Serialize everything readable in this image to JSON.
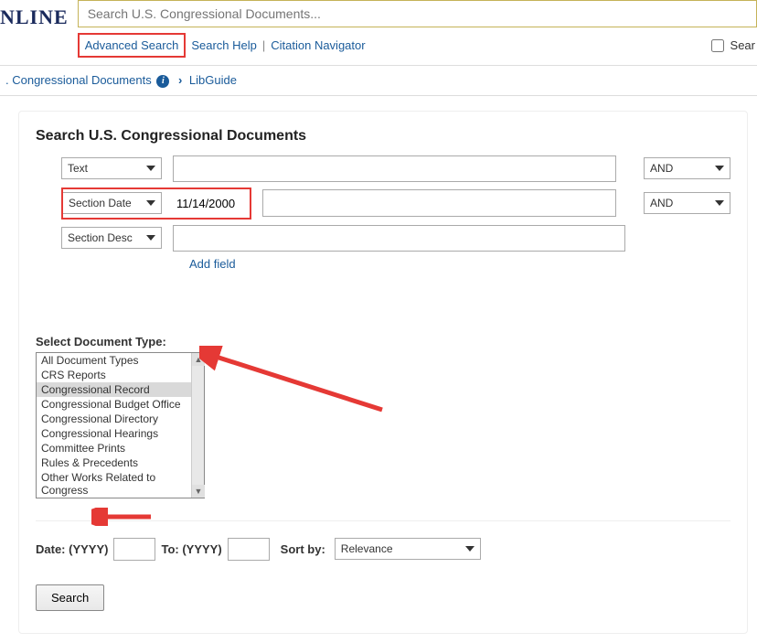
{
  "header": {
    "logo_fragment": "NLINE",
    "search_placeholder": "Search U.S. Congressional Documents...",
    "links": {
      "advanced": "Advanced Search",
      "help": "Search Help",
      "citation": "Citation Navigator"
    },
    "right_check_label": "Sear"
  },
  "breadcrumb": {
    "seg1": ". Congressional Documents",
    "seg2": "LibGuide"
  },
  "panel_title": "Search U.S. Congressional Documents",
  "rows": {
    "r1_field": "Text",
    "r1_value": "",
    "r1_bool": "AND",
    "r2_field": "Section Date",
    "r2_value": "11/14/2000",
    "r2_bool": "AND",
    "r3_field": "Section Desc",
    "r3_value": ""
  },
  "add_field_label": "Add field",
  "doc_type_label": "Select Document Type:",
  "doc_types": [
    "All Document Types",
    "CRS Reports",
    "Congressional Record",
    "Congressional Budget Office",
    "Congressional Directory",
    "Congressional Hearings",
    "Committee Prints",
    "Rules & Precedents",
    "Other Works Related to Congress"
  ],
  "doc_type_selected_index": 2,
  "date_row": {
    "from_label": "Date: (YYYY)",
    "to_label": "To: (YYYY)",
    "sort_label": "Sort by:",
    "sort_value": "Relevance"
  },
  "search_button": "Search"
}
